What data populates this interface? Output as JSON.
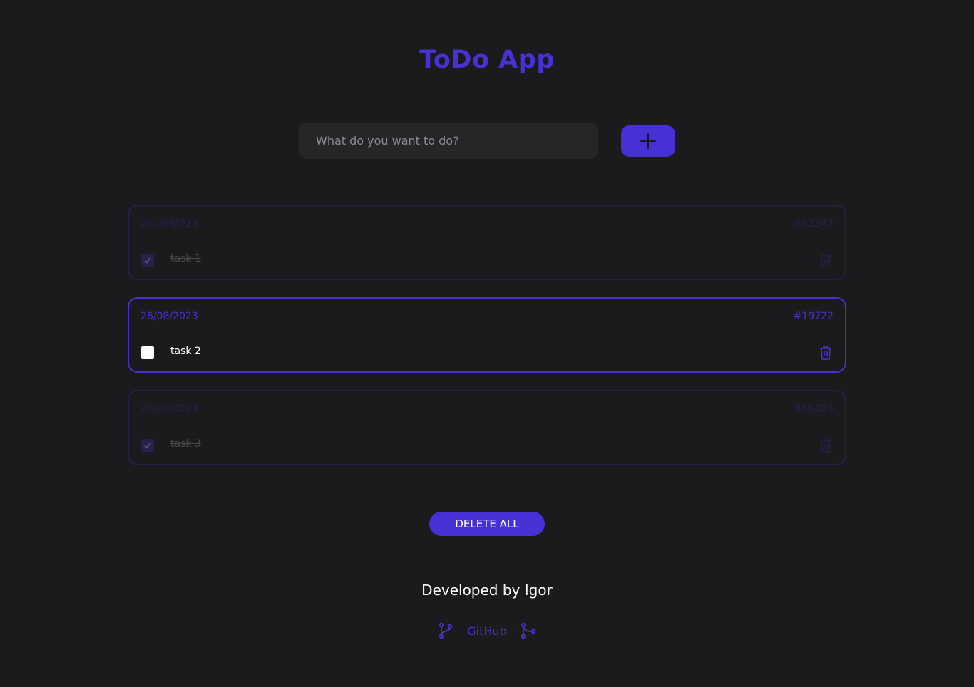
{
  "app": {
    "title": "ToDo App"
  },
  "form": {
    "placeholder": "What do you want to do?",
    "add_icon": "plus-icon"
  },
  "tasks": [
    {
      "date": "26/08/2023",
      "id": "#62342",
      "text": "task 1",
      "done": true
    },
    {
      "date": "26/08/2023",
      "id": "#19722",
      "text": "task 2",
      "done": false
    },
    {
      "date": "26/08/2023",
      "id": "#65886",
      "text": "task 3",
      "done": true
    }
  ],
  "actions": {
    "delete_all_label": "DELETE ALL"
  },
  "footer": {
    "developed_by": "Developed by Igor",
    "github_label": "GitHub"
  },
  "colors": {
    "accent": "#4632d4",
    "background": "#1b1b1e",
    "input_bg": "#262629"
  }
}
